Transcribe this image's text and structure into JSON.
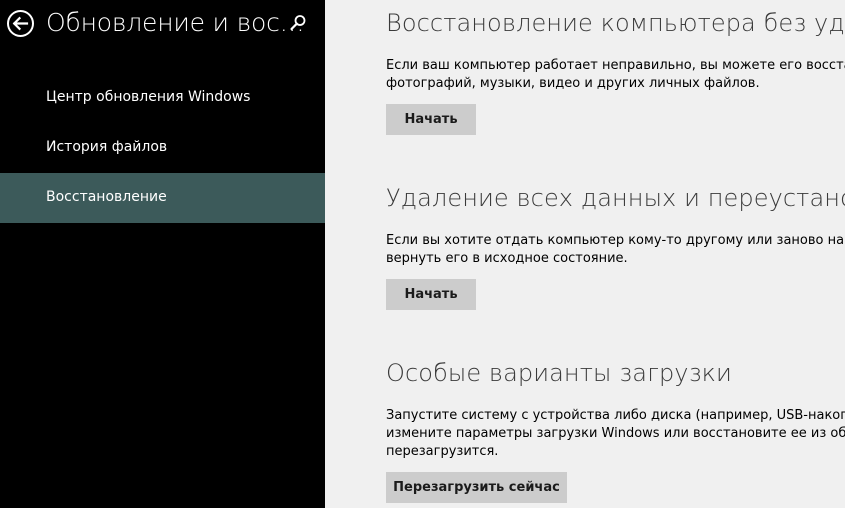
{
  "header": {
    "title": "Обновление и вос…",
    "back_icon": "back-arrow-icon",
    "search_icon": "search-icon"
  },
  "sidebar": {
    "items": [
      {
        "label": "Центр обновления Windows",
        "selected": false
      },
      {
        "label": "История файлов",
        "selected": false
      },
      {
        "label": "Восстановление",
        "selected": true
      }
    ],
    "selected_color": "#3c5a5a"
  },
  "main": {
    "sections": [
      {
        "title": "Восстановление компьютера без удален",
        "desc_lines": [
          "Если ваш компьютер работает неправильно, вы можете его восстанов",
          "фотографий, музыки, видео и других личных файлов."
        ],
        "button": "Начать"
      },
      {
        "title": "Удаление всех данных и переустановка",
        "desc_lines": [
          "Если вы хотите отдать компьютер кому-то другому или заново начать",
          "вернуть его в исходное состояние."
        ],
        "button": "Начать"
      },
      {
        "title": "Особые варианты загрузки",
        "desc_lines": [
          "Запустите систему с устройства либо диска (например, USB-накопител",
          "измените параметры загрузки Windows или восстановите ее из образ",
          "перезагрузится."
        ],
        "button": "Перезагрузить сейчас"
      }
    ]
  }
}
